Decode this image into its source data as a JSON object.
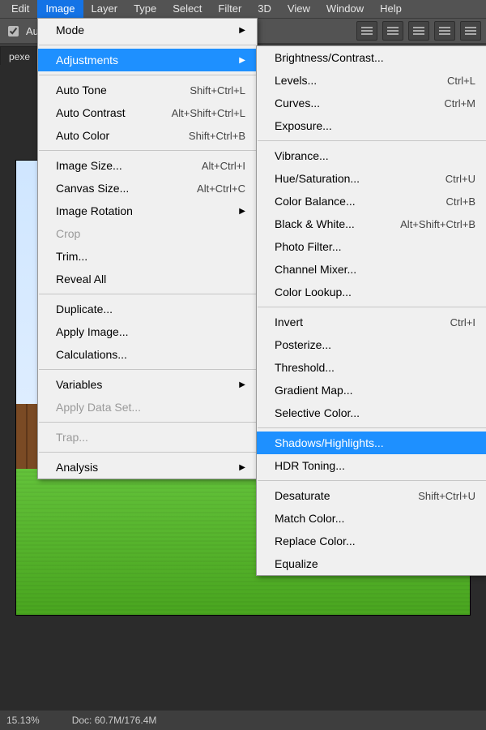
{
  "menubar": [
    "Edit",
    "Image",
    "Layer",
    "Type",
    "Select",
    "Filter",
    "3D",
    "View",
    "Window",
    "Help"
  ],
  "menubar_open_index": 1,
  "options_bar": {
    "auto_label": "Auto-"
  },
  "doc_tab": {
    "label": "pexe"
  },
  "statusbar": {
    "zoom": "15.13%",
    "doc": "Doc: 60.7M/176.4M"
  },
  "image_menu": {
    "groups": [
      [
        {
          "label": "Mode",
          "submenu": true
        }
      ],
      [
        {
          "label": "Adjustments",
          "submenu": true,
          "hover": true
        }
      ],
      [
        {
          "label": "Auto Tone",
          "shortcut": "Shift+Ctrl+L"
        },
        {
          "label": "Auto Contrast",
          "shortcut": "Alt+Shift+Ctrl+L"
        },
        {
          "label": "Auto Color",
          "shortcut": "Shift+Ctrl+B"
        }
      ],
      [
        {
          "label": "Image Size...",
          "shortcut": "Alt+Ctrl+I"
        },
        {
          "label": "Canvas Size...",
          "shortcut": "Alt+Ctrl+C"
        },
        {
          "label": "Image Rotation",
          "submenu": true
        },
        {
          "label": "Crop",
          "disabled": true
        },
        {
          "label": "Trim..."
        },
        {
          "label": "Reveal All"
        }
      ],
      [
        {
          "label": "Duplicate..."
        },
        {
          "label": "Apply Image..."
        },
        {
          "label": "Calculations..."
        }
      ],
      [
        {
          "label": "Variables",
          "submenu": true
        },
        {
          "label": "Apply Data Set...",
          "disabled": true
        }
      ],
      [
        {
          "label": "Trap...",
          "disabled": true
        }
      ],
      [
        {
          "label": "Analysis",
          "submenu": true
        }
      ]
    ]
  },
  "adjustments_menu": {
    "groups": [
      [
        {
          "label": "Brightness/Contrast..."
        },
        {
          "label": "Levels...",
          "shortcut": "Ctrl+L"
        },
        {
          "label": "Curves...",
          "shortcut": "Ctrl+M"
        },
        {
          "label": "Exposure..."
        }
      ],
      [
        {
          "label": "Vibrance..."
        },
        {
          "label": "Hue/Saturation...",
          "shortcut": "Ctrl+U"
        },
        {
          "label": "Color Balance...",
          "shortcut": "Ctrl+B"
        },
        {
          "label": "Black & White...",
          "shortcut": "Alt+Shift+Ctrl+B"
        },
        {
          "label": "Photo Filter..."
        },
        {
          "label": "Channel Mixer..."
        },
        {
          "label": "Color Lookup..."
        }
      ],
      [
        {
          "label": "Invert",
          "shortcut": "Ctrl+I"
        },
        {
          "label": "Posterize..."
        },
        {
          "label": "Threshold..."
        },
        {
          "label": "Gradient Map..."
        },
        {
          "label": "Selective Color..."
        }
      ],
      [
        {
          "label": "Shadows/Highlights...",
          "hover": true
        },
        {
          "label": "HDR Toning..."
        }
      ],
      [
        {
          "label": "Desaturate",
          "shortcut": "Shift+Ctrl+U"
        },
        {
          "label": "Match Color..."
        },
        {
          "label": "Replace Color..."
        },
        {
          "label": "Equalize"
        }
      ]
    ]
  }
}
